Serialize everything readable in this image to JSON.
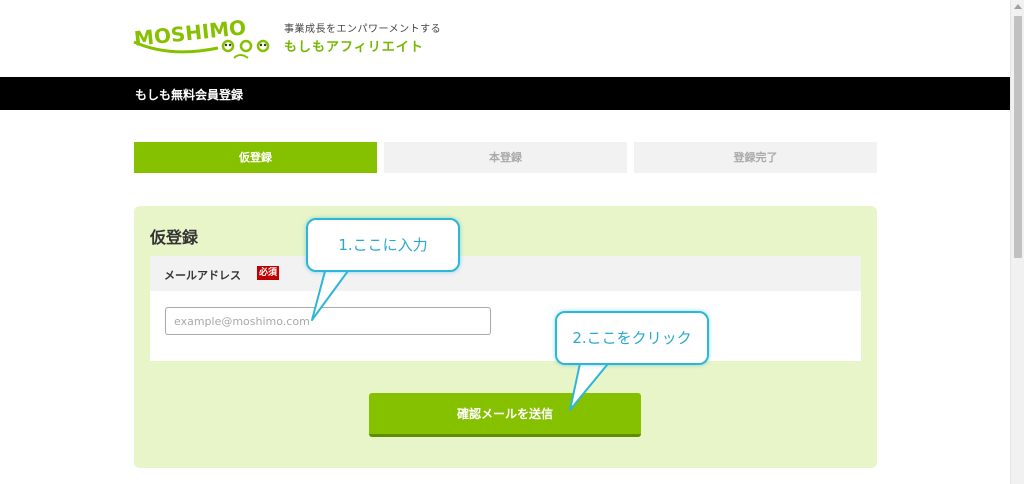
{
  "header": {
    "logo_text": "MOSHIMO",
    "tagline": "事業成長をエンパワーメントする",
    "brand_name": "もしもアフィリエイト"
  },
  "page_bar": {
    "title": "もしも無料会員登録"
  },
  "steps": [
    {
      "label": "仮登録",
      "active": true
    },
    {
      "label": "本登録",
      "active": false
    },
    {
      "label": "登録完了",
      "active": false
    }
  ],
  "form": {
    "title": "仮登録",
    "email_label": "メールアドレス",
    "required_badge": "必須",
    "email_placeholder": "example@moshimo.com",
    "email_value": "",
    "submit_label": "確認メールを送信"
  },
  "annotations": {
    "callout_1": "1.ここに入力",
    "callout_2": "2.ここをクリック"
  },
  "colors": {
    "accent_green": "#86c100",
    "panel_green": "#e8f5c8",
    "callout_blue": "#2eb6d8",
    "required_red": "#c00000"
  }
}
